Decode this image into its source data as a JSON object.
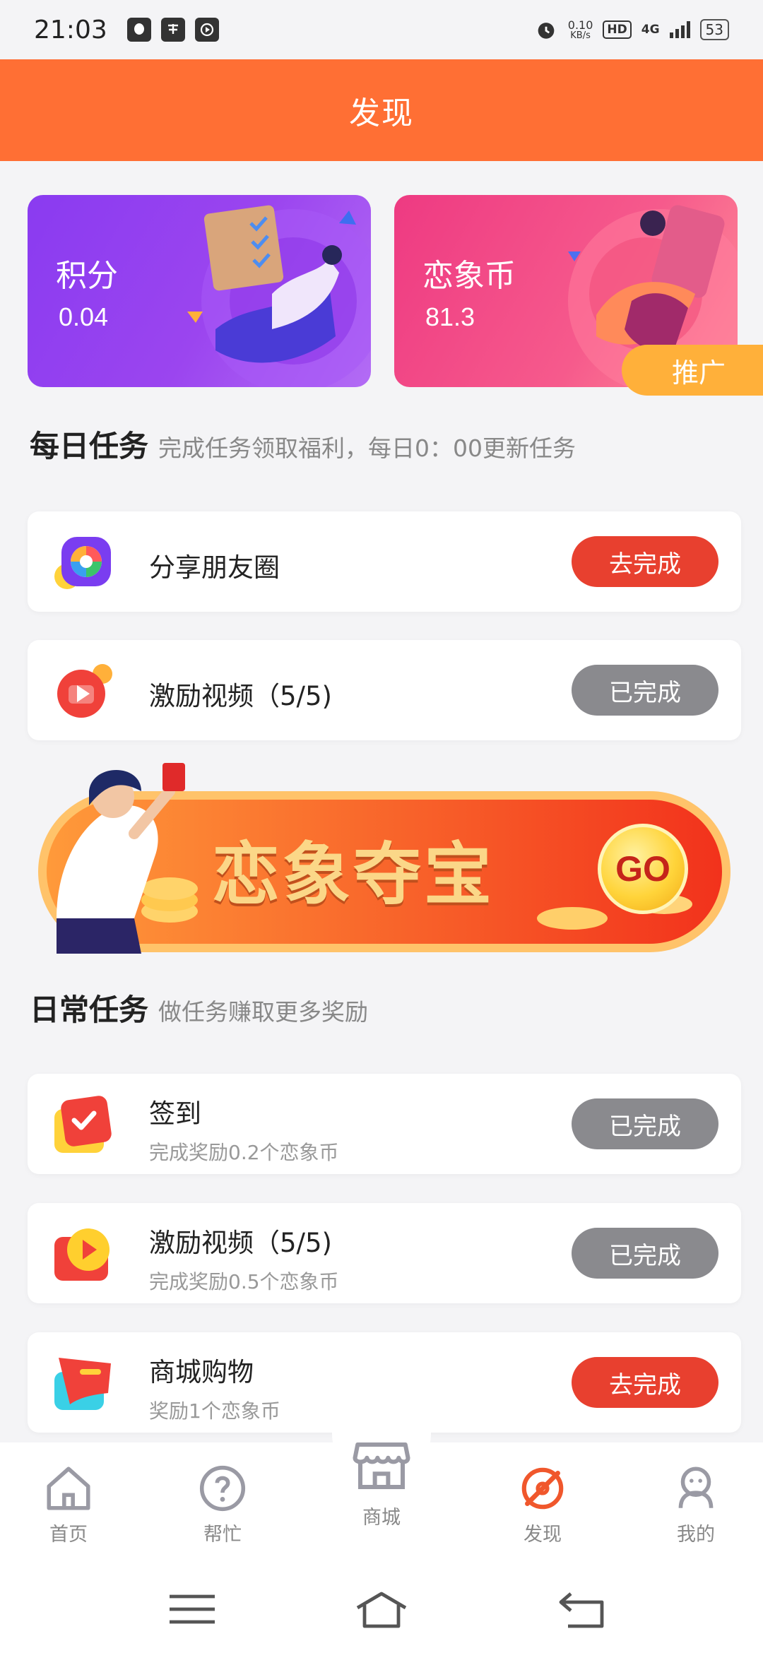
{
  "status_bar": {
    "time": "21:03",
    "speed_value": "0.10",
    "speed_unit": "KB/s",
    "hd": "HD",
    "network": "4G",
    "battery": "53"
  },
  "header": {
    "title": "发现"
  },
  "cards": {
    "points": {
      "title": "积分",
      "value": "0.04"
    },
    "coins": {
      "title": "恋象币",
      "value": "81.3"
    },
    "promo_label": "推广"
  },
  "daily": {
    "title": "每日任务",
    "subtitle": "完成任务领取福利，每日0：00更新任务",
    "tasks": [
      {
        "name": "分享朋友圈",
        "button": "去完成",
        "status": "todo"
      },
      {
        "name": "激励视频（5/5)",
        "button": "已完成",
        "status": "done"
      }
    ]
  },
  "banner": {
    "text": "恋象夺宝",
    "go": "GO"
  },
  "routine": {
    "title": "日常任务",
    "subtitle": "做任务赚取更多奖励",
    "tasks": [
      {
        "name": "签到",
        "desc": "完成奖励0.2个恋象币",
        "button": "已完成",
        "status": "done"
      },
      {
        "name": "激励视频（5/5)",
        "desc": "完成奖励0.5个恋象币",
        "button": "已完成",
        "status": "done"
      },
      {
        "name": "商城购物",
        "desc": "奖励1个恋象币",
        "button": "去完成",
        "status": "todo"
      }
    ]
  },
  "tabs": [
    {
      "label": "首页"
    },
    {
      "label": "帮忙"
    },
    {
      "label": "商城"
    },
    {
      "label": "发现"
    },
    {
      "label": "我的"
    }
  ],
  "colors": {
    "accent": "#ff6f34",
    "todo_button": "#e8402f",
    "done_button": "#8a8a8e",
    "active_tab": "#f0572c"
  },
  "icons": {
    "status": [
      "qq-icon",
      "alipay-icon",
      "video-icon",
      "alarm-icon",
      "signal-icon",
      "battery-icon"
    ],
    "tabs": [
      "home-icon",
      "help-icon",
      "shop-icon",
      "discover-icon",
      "profile-icon"
    ],
    "system": [
      "menu-icon",
      "home-nav-icon",
      "back-icon"
    ]
  }
}
